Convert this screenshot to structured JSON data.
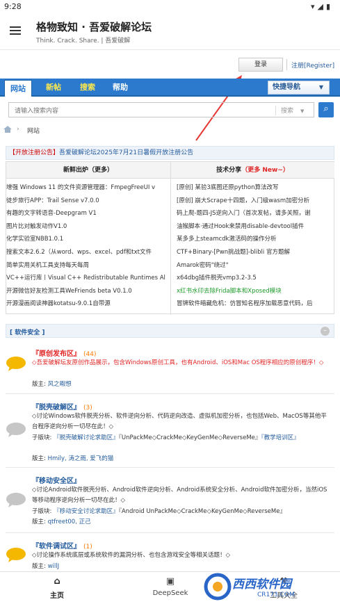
{
  "status": {
    "time": "9:28"
  },
  "app": {
    "title": "格物致知 · 吾爱破解论坛",
    "subtitle": "Think. Crack. Share. | 吾爱破解"
  },
  "auth": {
    "login": "登录",
    "register": "注册[Register]"
  },
  "nav": {
    "tabs": [
      "网站",
      "新帖",
      "搜索",
      "帮助"
    ],
    "quick": "快捷导航"
  },
  "search": {
    "placeholder": "请输入搜索内容",
    "type": "搜索"
  },
  "breadcrumb": {
    "current": "网站"
  },
  "notice": {
    "tag": "【开放注册公告】",
    "text": "吾爱破解论坛2025年7月21日暑假开放注册公告"
  },
  "left_col": {
    "title": "新鲜出炉（更多）",
    "items": [
      "增强 Windows 11 的文件资源管理器：FmpegFreeUI v",
      "徒步旅行APP：Trail Sense v7.0.0",
      "有趣的文字转语音-Deepgram V1",
      "图片比对触发动作V1.0",
      "化学实验室NBB1.0.1",
      "搜索文本2.6.2（从word、wps、excel、pdf和txt文件",
      "简单实用关机工具支持每天每周",
      "VC++运行库丨Visual C++ Redistributable Runtimes Al",
      "开源微信好友检测工具WeFriends beta V0.1.0",
      "开源漫画阅读神器kotatsu-9.0.1自带源"
    ]
  },
  "right_col": {
    "title": "技术分享",
    "title_more": "（更多 New~）",
    "items": [
      "[原创] 某验3底图还原python算法改写",
      "[原创] 崩大Scrape十四题，入门级wasm加密分析",
      "码上爬-题四-JS逆向入门（首次发帖，请多关照，谢",
      "油猴脚本·通过Hook来禁用disable-devtool插件",
      "某多多上steamcdk激活码的操作分析",
      "CTF+Binary-[Pwn挑战题]-blibli 官方题解",
      "Amarok密码\"绕过\"",
      "x64dbg插件脱壳vmp3.2-3.5",
      "x红书水印去除Frida脚本和Xposed模块",
      "冒牌软件暗藏危机：仿冒知名程序加载恶意代码，后"
    ]
  },
  "section": {
    "title": "[ 软件安全 ]"
  },
  "forums": [
    {
      "name": "『原创发布区』",
      "count": "(44)",
      "desc": "◇吾爱破解坛友原创作品展示，包含Windows原创工具，也有Android、iOS和Mac OS程序相应的原创程序！◇",
      "moderators_label": "版主:",
      "moderators": "风之暇想"
    },
    {
      "name": "『脱壳破解区』",
      "count": "(3)",
      "desc": "◇讨论Windows软件脱壳分析、软件逆向分析、代码逆向改造、虚拟机加密分析，也包括Web、MacOS等其他平台程序逆向分析一切尽在此！◇",
      "sub_label": "子版块:",
      "subforums": [
        "『脱壳破解讨论求助区』",
        "『UnPackMe◇CrackMe◇KeyGenMe◇ReverseMe』",
        "『教学培训区』"
      ],
      "moderators_label": "版主:",
      "moderators": "Hmily, 涛之雨, 爱飞的猫"
    },
    {
      "name": "『移动安全区』",
      "count": "",
      "desc": "◇讨论Android软件脱壳分析、Android软件逆向分析、Android系统安全分析、Android软件加密分析，当然iOS等移动程序逆向分析一切尽在此！◇",
      "sub_label": "子版块:",
      "subforums": [
        "『移动安全讨论求助区』",
        "『Android UnPackMe◇CrackMe◇KeyGenMe◇ReverseMe』"
      ],
      "moderators_label": "版主:",
      "moderators": "qtfreet00, 正己"
    },
    {
      "name": "『软件调试区』",
      "count": "(1)",
      "desc": "◇讨论操作系统底层或系统软件的漏洞分析、也包含游戏安全等相关话题！◇",
      "moderators_label": "版主:",
      "moderators": "willJ"
    }
  ],
  "bottom_nav": {
    "home": "主页",
    "deepseek": "DeepSeek",
    "tools": "工具大全"
  },
  "watermark": {
    "brand": "西西软件园",
    "url": "CR173.COM"
  },
  "colors": {
    "accent": "#2b7acd",
    "link": "#235b9c",
    "red": "#e02424",
    "orange": "#ff7a00",
    "green": "#1e9b2b"
  }
}
